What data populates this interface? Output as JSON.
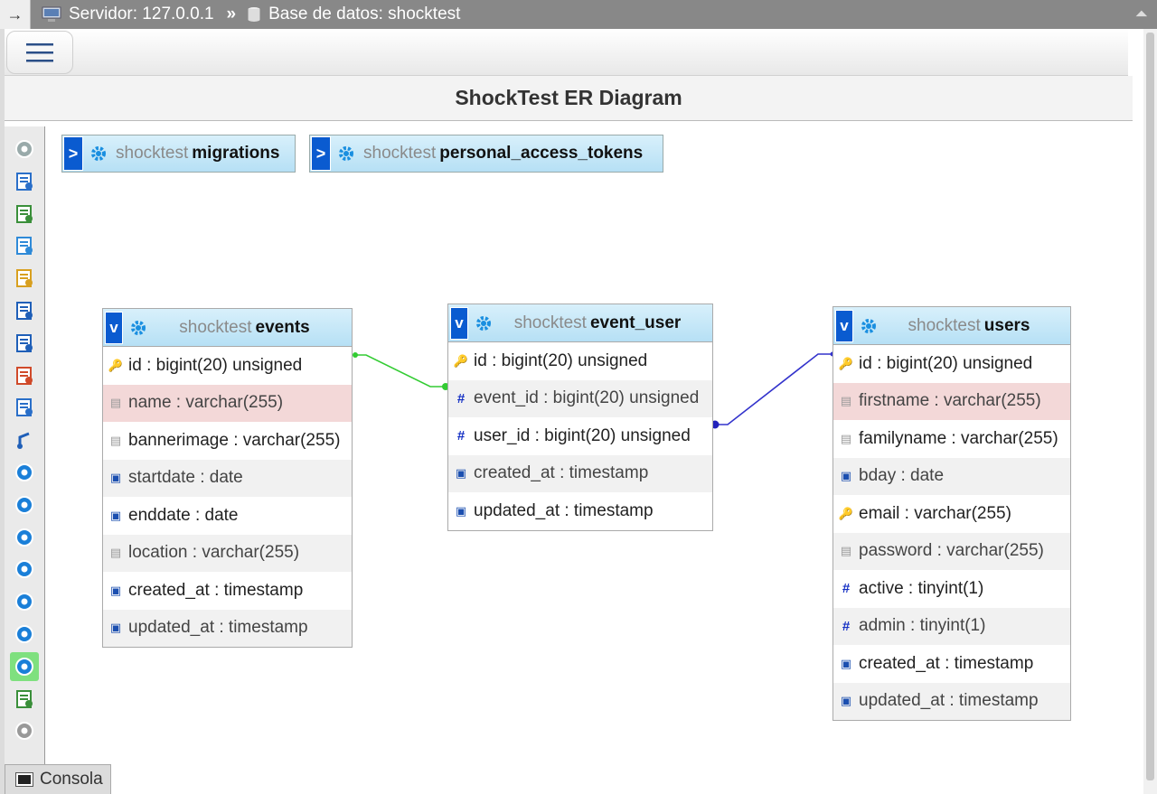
{
  "breadcrumb": {
    "server": "Servidor: 127.0.0.1",
    "separator": "»",
    "database": "Base de datos: shocktest"
  },
  "title": "ShockTest ER Diagram",
  "console_label": "Consola",
  "collapsed_tables": [
    {
      "db": "shocktest",
      "name": "migrations",
      "toggle": ">"
    },
    {
      "db": "shocktest",
      "name": "personal_access_tokens",
      "toggle": ">"
    }
  ],
  "tables": {
    "events": {
      "db": "shocktest",
      "name": "events",
      "toggle": "v",
      "columns": [
        {
          "text": "id : bigint(20) unsigned",
          "icon": "key"
        },
        {
          "text": "name : varchar(255)",
          "icon": "text"
        },
        {
          "text": "bannerimage : varchar(255)",
          "icon": "text"
        },
        {
          "text": "startdate : date",
          "icon": "date"
        },
        {
          "text": "enddate : date",
          "icon": "date"
        },
        {
          "text": "location : varchar(255)",
          "icon": "text"
        },
        {
          "text": "created_at : timestamp",
          "icon": "date"
        },
        {
          "text": "updated_at : timestamp",
          "icon": "date"
        }
      ]
    },
    "event_user": {
      "db": "shocktest",
      "name": "event_user",
      "toggle": "v",
      "columns": [
        {
          "text": "id : bigint(20) unsigned",
          "icon": "key"
        },
        {
          "text": "event_id : bigint(20) unsigned",
          "icon": "hash"
        },
        {
          "text": "user_id : bigint(20) unsigned",
          "icon": "hash"
        },
        {
          "text": "created_at : timestamp",
          "icon": "date"
        },
        {
          "text": "updated_at : timestamp",
          "icon": "date"
        }
      ]
    },
    "users": {
      "db": "shocktest",
      "name": "users",
      "toggle": "v",
      "columns": [
        {
          "text": "id : bigint(20) unsigned",
          "icon": "key"
        },
        {
          "text": "firstname : varchar(255)",
          "icon": "text"
        },
        {
          "text": "familyname : varchar(255)",
          "icon": "text"
        },
        {
          "text": "bday : date",
          "icon": "date"
        },
        {
          "text": "email : varchar(255)",
          "icon": "key"
        },
        {
          "text": "password : varchar(255)",
          "icon": "text"
        },
        {
          "text": "active : tinyint(1)",
          "icon": "hash"
        },
        {
          "text": "admin : tinyint(1)",
          "icon": "hash"
        },
        {
          "text": "created_at : timestamp",
          "icon": "date"
        },
        {
          "text": "updated_at : timestamp",
          "icon": "date"
        }
      ]
    }
  },
  "relation_colors": {
    "events_event_user": "#33cc33",
    "users_event_user": "#3333cc"
  },
  "toolbar_icons": [
    "toggle-icon",
    "fullscreen-icon",
    "add-tables-icon",
    "new-page-icon",
    "edit-page-icon",
    "save-page-icon",
    "save-as-icon",
    "delete-page-icon",
    "view-schema-icon",
    "relation-icon",
    "reload-icon",
    "help-icon",
    "angular-links-icon",
    "snap-grid-icon",
    "small-big-all-icon",
    "toggle-small-big-icon",
    "toggle-relation-lines-icon",
    "export-icon",
    "move-menu-icon"
  ]
}
